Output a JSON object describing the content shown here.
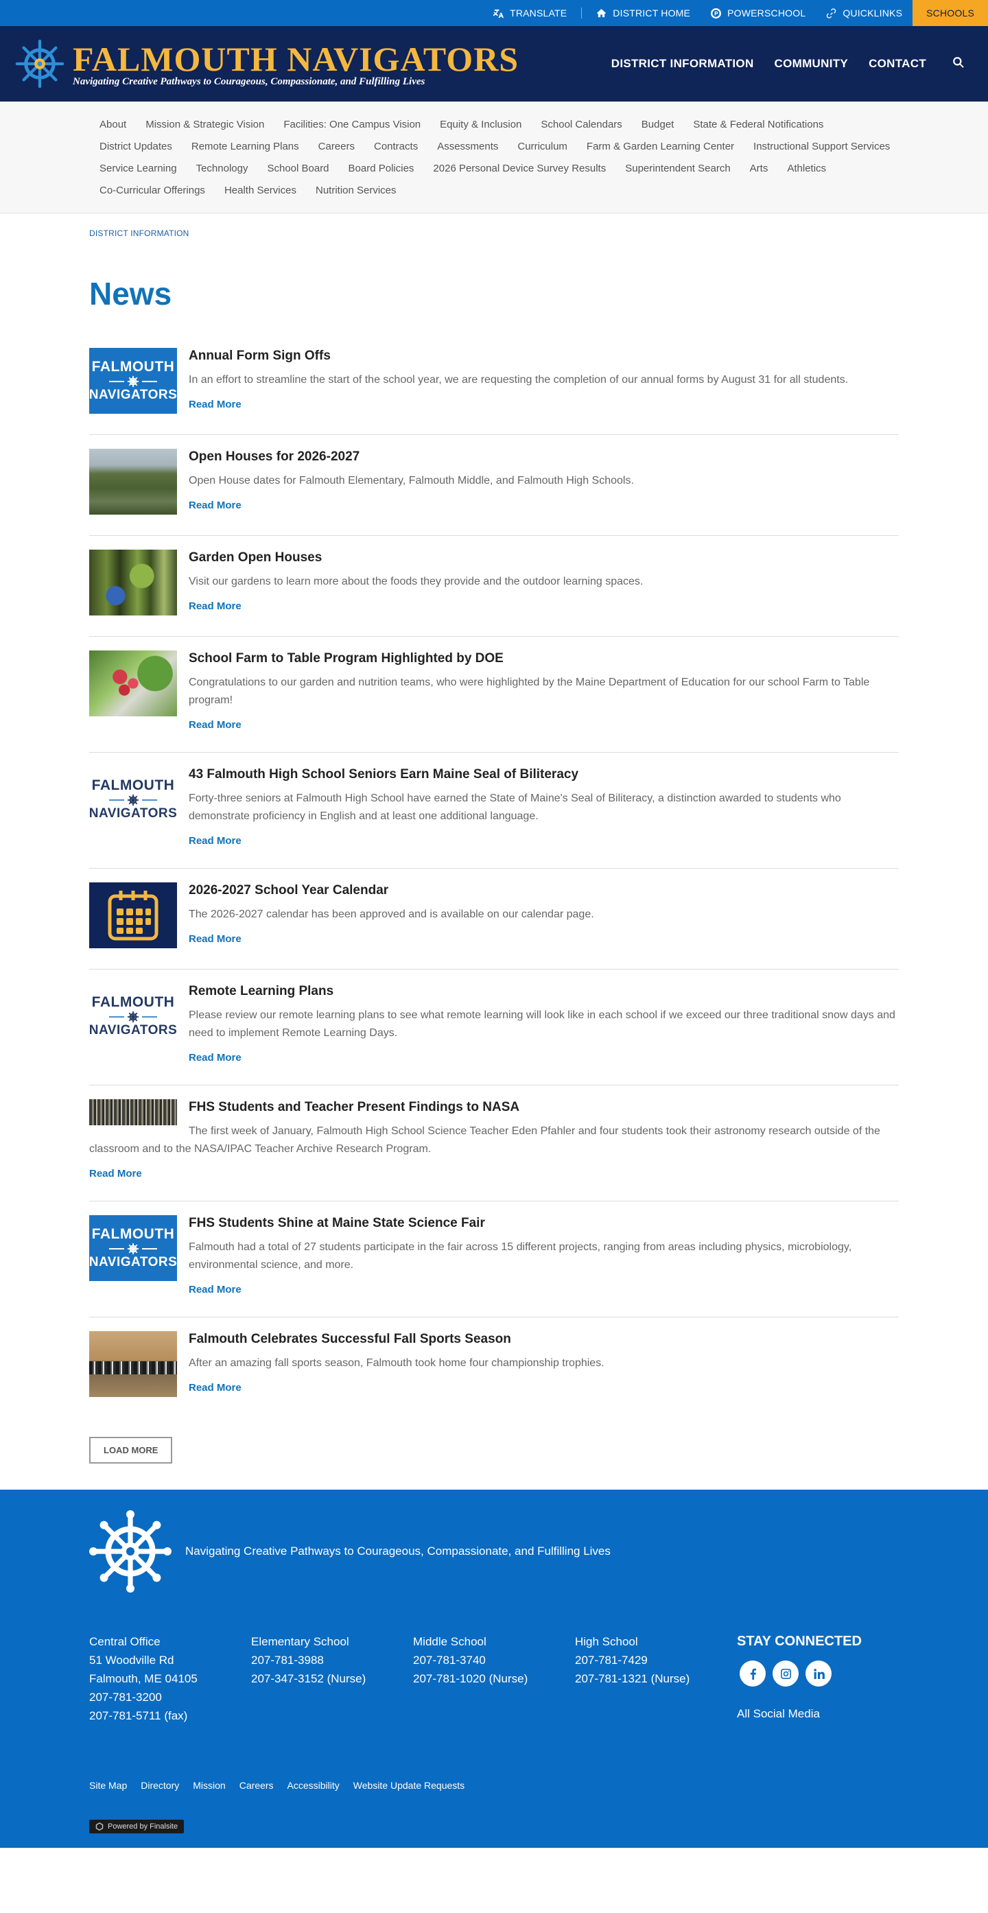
{
  "utility": {
    "translate": "TRANSLATE",
    "district_home": "DISTRICT HOME",
    "powerschool": "POWERSCHOOL",
    "quicklinks": "QUICKLINKS",
    "schools": "SCHOOLS"
  },
  "header": {
    "logo_title": "FALMOUTH NAVIGATORS",
    "logo_tagline": "Navigating Creative Pathways to Courageous, Compassionate, and Fulfilling Lives",
    "nav": [
      "DISTRICT INFORMATION",
      "COMMUNITY",
      "CONTACT"
    ]
  },
  "subnav": [
    "About",
    "Mission & Strategic Vision",
    "Facilities: One Campus Vision",
    "Equity & Inclusion",
    "School Calendars",
    "Budget",
    "State & Federal Notifications",
    "District Updates",
    "Remote Learning Plans",
    "Careers",
    "Contracts",
    "Assessments",
    "Curriculum",
    "Farm & Garden Learning Center",
    "Instructional Support Services",
    "Service Learning",
    "Technology",
    "School Board",
    "Board Policies",
    "2026 Personal Device Survey Results",
    "Superintendent Search",
    "Arts",
    "Athletics",
    "Co-Curricular Offerings",
    "Health Services",
    "Nutrition Services"
  ],
  "breadcrumb": "DISTRICT INFORMATION",
  "page_title": "News",
  "read_more": "Read More",
  "news": [
    {
      "title": "Annual Form Sign Offs",
      "summary": "In an effort to streamline the start of the school year, we are requesting the completion of our annual forms by August 31 for all students."
    },
    {
      "title": "Open Houses for 2026-2027",
      "summary": "Open House dates for Falmouth Elementary, Falmouth Middle, and Falmouth High Schools."
    },
    {
      "title": "Garden Open Houses",
      "summary": "Visit our gardens to learn more about the foods they provide and the outdoor learning spaces."
    },
    {
      "title": "School Farm to Table Program Highlighted by DOE",
      "summary": "Congratulations to our garden and nutrition teams, who were highlighted by the Maine Department of Education for our school Farm to Table program!"
    },
    {
      "title": "43 Falmouth High School Seniors Earn Maine Seal of Biliteracy",
      "summary": "Forty-three seniors at Falmouth High School have earned the State of Maine's Seal of Biliteracy, a distinction awarded to students who demonstrate proficiency in English and at least one additional language."
    },
    {
      "title": "2026-2027 School Year Calendar",
      "summary": "The 2026-2027 calendar has been approved and is available on our calendar page."
    },
    {
      "title": "Remote Learning Plans",
      "summary": "Please review our remote learning plans to see what remote learning will look like in each school if we exceed our three traditional snow days and need to implement Remote Learning Days."
    },
    {
      "title": "FHS Students and Teacher Present Findings to NASA",
      "summary": "The first week of January, Falmouth High School Science Teacher Eden Pfahler and four students took their astronomy research outside of the classroom and to the NASA/IPAC Teacher Archive Research Program."
    },
    {
      "title": "FHS Students Shine at Maine State Science Fair",
      "summary": "Falmouth had a total of 27 students participate in the fair across 15 different projects, ranging from areas including physics, microbiology, environmental science, and more."
    },
    {
      "title": "Falmouth Celebrates Successful Fall Sports Season",
      "summary": "After an amazing fall sports season, Falmouth took home four championship trophies."
    }
  ],
  "thumb_logo": {
    "line1": "FALMOUTH",
    "line2": "NAVIGATORS"
  },
  "load_more": "LOAD MORE",
  "footer": {
    "tagline": "Navigating Creative Pathways to Courageous, Compassionate, and Fulfilling Lives",
    "central": [
      "Central Office",
      "51 Woodville Rd",
      "Falmouth, ME 04105",
      "207-781-3200",
      "207-781-5711 (fax)"
    ],
    "elementary": [
      "Elementary School",
      "207-781-3988",
      "207-347-3152 (Nurse)"
    ],
    "middle": [
      "Middle School",
      "207-781-3740",
      "207-781-1020 (Nurse)"
    ],
    "high": [
      "High School",
      "207-781-7429",
      "207-781-1321 (Nurse)"
    ],
    "stay_connected": "STAY CONNECTED",
    "all_social": "All Social Media",
    "links": [
      "Site Map",
      "Directory",
      "Mission",
      "Careers",
      "Accessibility",
      "Website Update Requests"
    ],
    "powered": "Powered by Finalsite"
  },
  "colors": {
    "utility_bar": "#0a6bc2",
    "header": "#0f2457",
    "accent_gold": "#f5a623",
    "link_blue": "#1272b8",
    "footer": "#0a6bc2"
  }
}
